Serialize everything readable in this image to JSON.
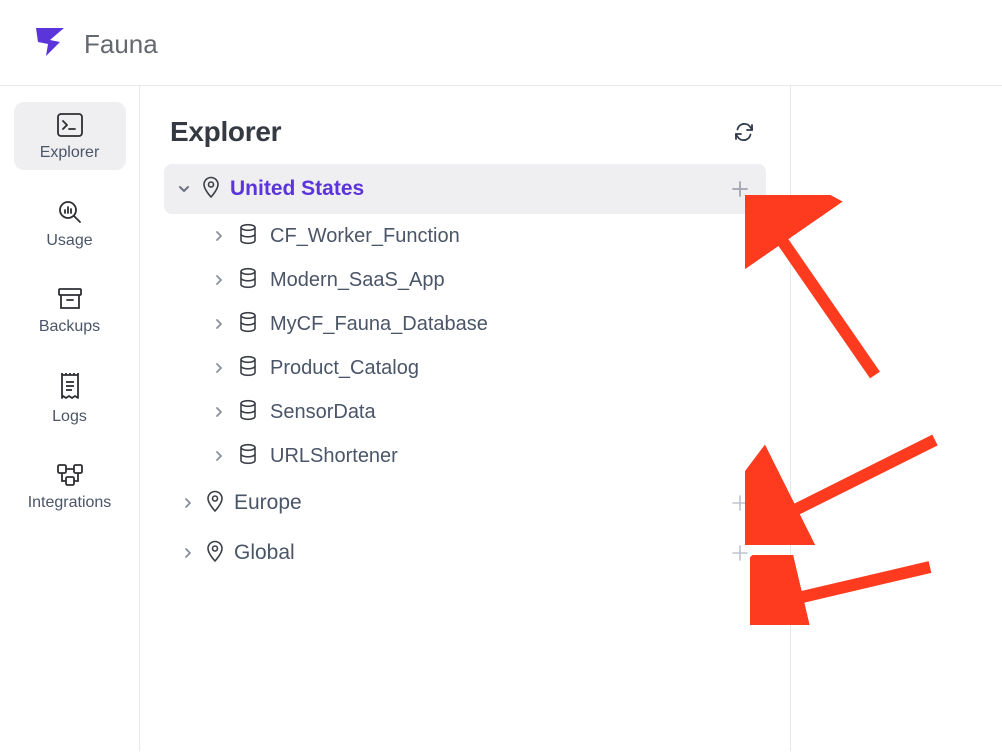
{
  "brand": {
    "name": "Fauna"
  },
  "sidebar": {
    "items": [
      {
        "label": "Explorer",
        "icon": "terminal-icon",
        "active": true
      },
      {
        "label": "Usage",
        "icon": "analytics-icon",
        "active": false
      },
      {
        "label": "Backups",
        "icon": "archive-icon",
        "active": false
      },
      {
        "label": "Logs",
        "icon": "receipt-icon",
        "active": false
      },
      {
        "label": "Integrations",
        "icon": "integrations-icon",
        "active": false
      }
    ]
  },
  "explorer": {
    "title": "Explorer",
    "regions": [
      {
        "name": "United States",
        "expanded": true,
        "selected": true,
        "databases": [
          "CF_Worker_Function",
          "Modern_SaaS_App",
          "MyCF_Fauna_Database",
          "Product_Catalog",
          "SensorData",
          "URLShortener"
        ]
      },
      {
        "name": "Europe",
        "expanded": false,
        "selected": false,
        "databases": []
      },
      {
        "name": "Global",
        "expanded": false,
        "selected": false,
        "databases": []
      }
    ]
  }
}
